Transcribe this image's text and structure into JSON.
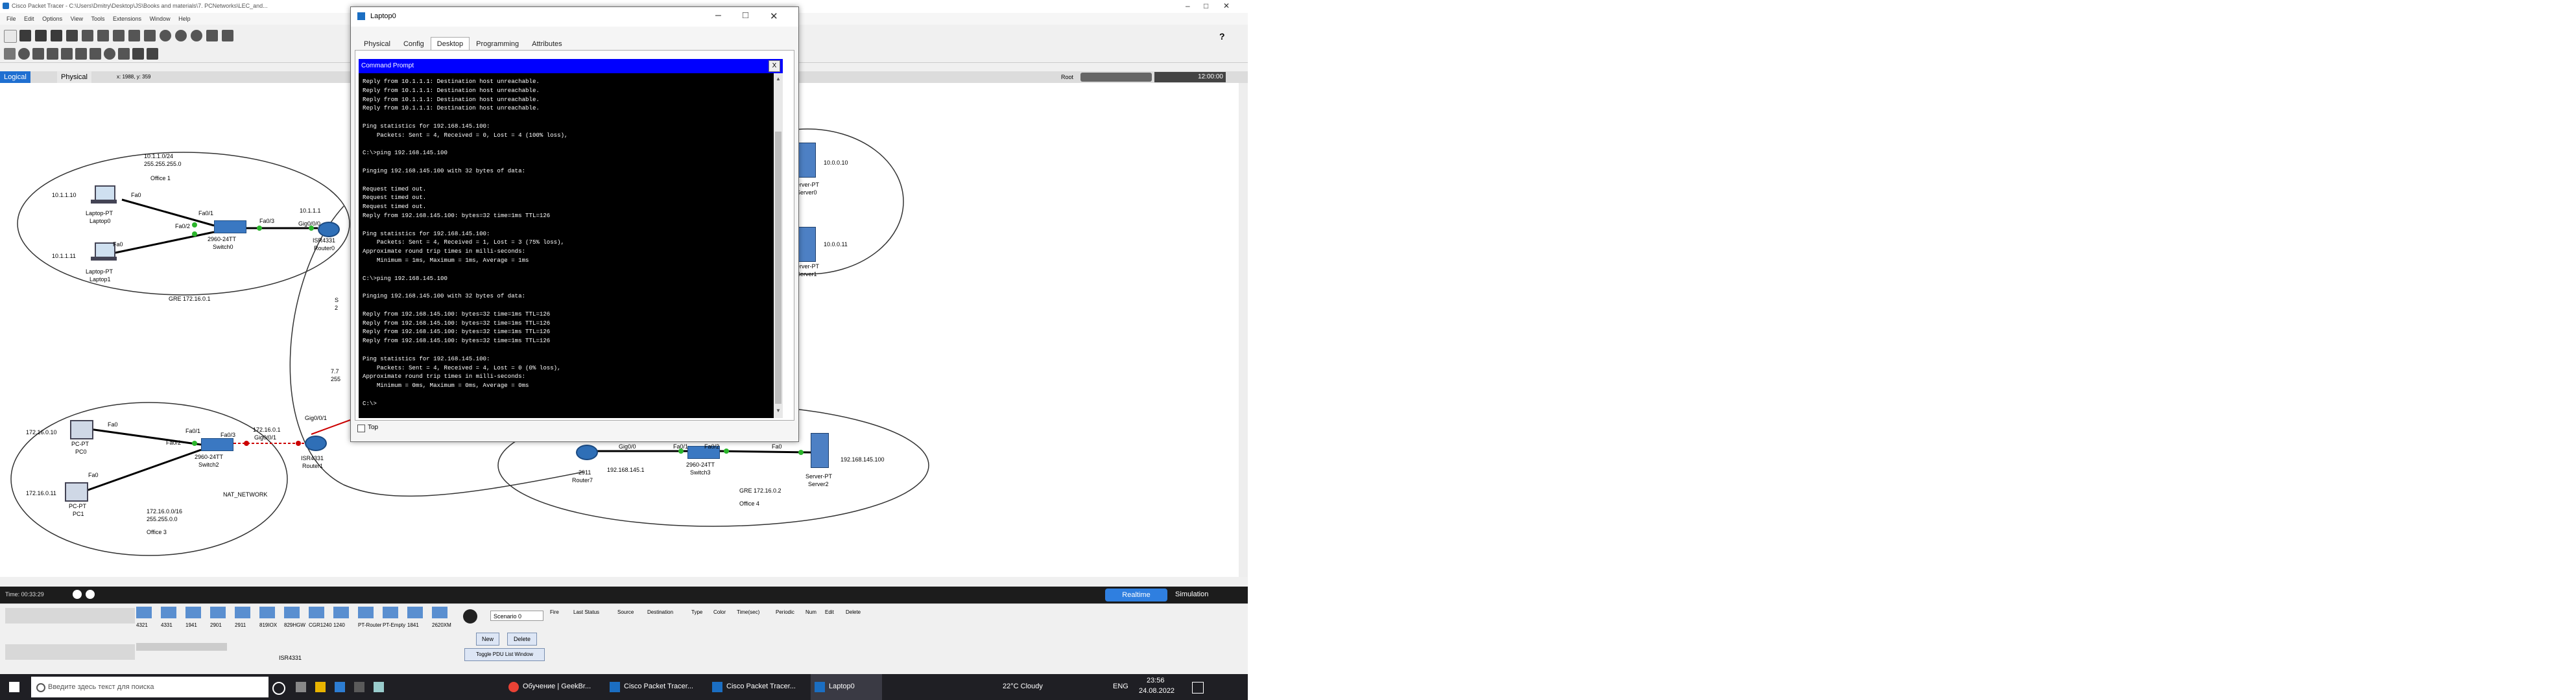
{
  "app": {
    "title": "Cisco Packet Tracer - C:\\Users\\Dmitry\\Desktop\\JS\\Books and materials\\7. PCNetworks\\LEC_and...",
    "menu": [
      "File",
      "Edit",
      "Options",
      "View",
      "Tools",
      "Extensions",
      "Window",
      "Help"
    ],
    "view_tabs": {
      "logical": "Logical",
      "physical": "Physical",
      "coords": "x: 1988, y: 359"
    },
    "root_label": "Root",
    "clock": "12:00:00"
  },
  "topology": {
    "labels": {
      "net_office1": "10.1.1.0/24",
      "mask_office1": "255.255.255.0",
      "office1": "Office 1",
      "ip_laptop0": "10.1.1.10",
      "ip_laptop1": "10.1.1.11",
      "laptop0": "Laptop-PT",
      "laptop0_name": "Laptop0",
      "laptop1": "Laptop-PT",
      "laptop1_name": "Laptop1",
      "fa0_a": "Fa0",
      "fa0_b": "Fa0",
      "fa01_sw0": "Fa0/1",
      "fa02_sw0": "Fa0/2",
      "fa03_sw0": "Fa0/3",
      "switch0_model": "2960-24TT",
      "switch0_name": "Switch0",
      "gre1": "GRE 172.16.0.1",
      "ip_router0": "10.1.1.1",
      "gig000": "Gig0/0/0",
      "router0_model": "ISR4331",
      "router0_name": "Router0",
      "ip_server_a": "10.0.0.10",
      "ip_server_b": "10.0.0.11",
      "server_a": "Server-PT",
      "server_a_name": "Server0",
      "server_b": "Server-PT",
      "server_b_name": "Server1",
      "s_label": "S",
      "s2_label": "2",
      "seven": "7.7",
      "two55": "255",
      "ip_pc0": "172.16.0.10",
      "ip_pc1": "172.16.0.11",
      "pc0": "PC-PT",
      "pc0_name": "PC0",
      "pc1": "PC-PT",
      "pc1_name": "PC1",
      "fa0_pc0": "Fa0",
      "fa0_pc1": "Fa0",
      "fa01_sw2": "Fa0/1",
      "fa02_sw2": "Fa0/2",
      "fa03_sw2": "Fa0/3",
      "switch2_model": "2960-24TT",
      "switch2_name": "Switch2",
      "gig001": "Gig0/0/1",
      "ip_r1": "172.16.0.1",
      "gig001b": "Gig0/0/1",
      "router1_model": "ISR4331",
      "router1_name": "Router1",
      "nat": "NAT_NETWORK",
      "net_office3": "172.16.0.0/16",
      "mask_office3": "255.255.0.0",
      "office3": "Office 3",
      "router_2911": "2911",
      "router7": "Router7",
      "gig00_r7": "Gig0/0",
      "ip_r7": "192.168.145.1",
      "fa01_sw3": "Fa0/1",
      "fa02_sw3": "Fa0/2",
      "switch3_model": "2960-24TT",
      "switch3_name": "Switch3",
      "fa0_srv2": "Fa0",
      "ip_srv2": "192.168.145.100",
      "server2": "Server-PT",
      "server2_name": "Server2",
      "gre2": "GRE 172.16.0.2",
      "office4": "Office 4"
    }
  },
  "timebar": {
    "time": "Time: 00:33:29",
    "realtime": "Realtime",
    "simulation": "Simulation"
  },
  "bottom_panel": {
    "scenario": "Scenario 0",
    "new_btn": "New",
    "delete_btn": "Delete",
    "toggle_pdu": "Toggle PDU List Window",
    "device_caption": "ISR4331",
    "device_models": [
      "4321",
      "4331",
      "1941",
      "2901",
      "2911",
      "819IOX",
      "829HGW",
      "CGR1240",
      "1240",
      "PT-Router",
      "PT-Empty",
      "1841",
      "2620XM"
    ],
    "event_cols": [
      "Fire",
      "Last Status",
      "Source",
      "Destination",
      "Type",
      "Color",
      "Time(sec)",
      "Periodic",
      "Num",
      "Edit",
      "Delete"
    ]
  },
  "dialog": {
    "title": "Laptop0",
    "tabs": [
      "Physical",
      "Config",
      "Desktop",
      "Programming",
      "Attributes"
    ],
    "active_tab": "Desktop",
    "cmd_title": "Command Prompt",
    "close_glyph": "X",
    "top_label": "Top",
    "output": "Reply from 10.1.1.1: Destination host unreachable.\nReply from 10.1.1.1: Destination host unreachable.\nReply from 10.1.1.1: Destination host unreachable.\nReply from 10.1.1.1: Destination host unreachable.\n\nPing statistics for 192.168.145.100:\n    Packets: Sent = 4, Received = 0, Lost = 4 (100% loss),\n\nC:\\>ping 192.168.145.100\n\nPinging 192.168.145.100 with 32 bytes of data:\n\nRequest timed out.\nRequest timed out.\nRequest timed out.\nReply from 192.168.145.100: bytes=32 time=1ms TTL=126\n\nPing statistics for 192.168.145.100:\n    Packets: Sent = 4, Received = 1, Lost = 3 (75% loss),\nApproximate round trip times in milli-seconds:\n    Minimum = 1ms, Maximum = 1ms, Average = 1ms\n\nC:\\>ping 192.168.145.100\n\nPinging 192.168.145.100 with 32 bytes of data:\n\nReply from 192.168.145.100: bytes=32 time=1ms TTL=126\nReply from 192.168.145.100: bytes=32 time=1ms TTL=126\nReply from 192.168.145.100: bytes=32 time=1ms TTL=126\nReply from 192.168.145.100: bytes=32 time=1ms TTL=126\n\nPing statistics for 192.168.145.100:\n    Packets: Sent = 4, Received = 4, Lost = 0 (0% loss),\nApproximate round trip times in milli-seconds:\n    Minimum = 0ms, Maximum = 0ms, Average = 0ms\n\nC:\\>"
  },
  "taskbar": {
    "search_placeholder": "Введите здесь текст для поиска",
    "items": [
      "Обучение | GeekBr...",
      "Cisco Packet Tracer...",
      "Cisco Packet Tracer...",
      "Laptop0"
    ],
    "weather": "22°C  Cloudy",
    "lang": "ENG",
    "time": "23:56",
    "date": "24.08.2022"
  },
  "colors": {
    "accent": "#0000ff",
    "realtime": "#2f7fe0",
    "terminal_bg": "#000000",
    "taskbar": "#1f1f24"
  }
}
